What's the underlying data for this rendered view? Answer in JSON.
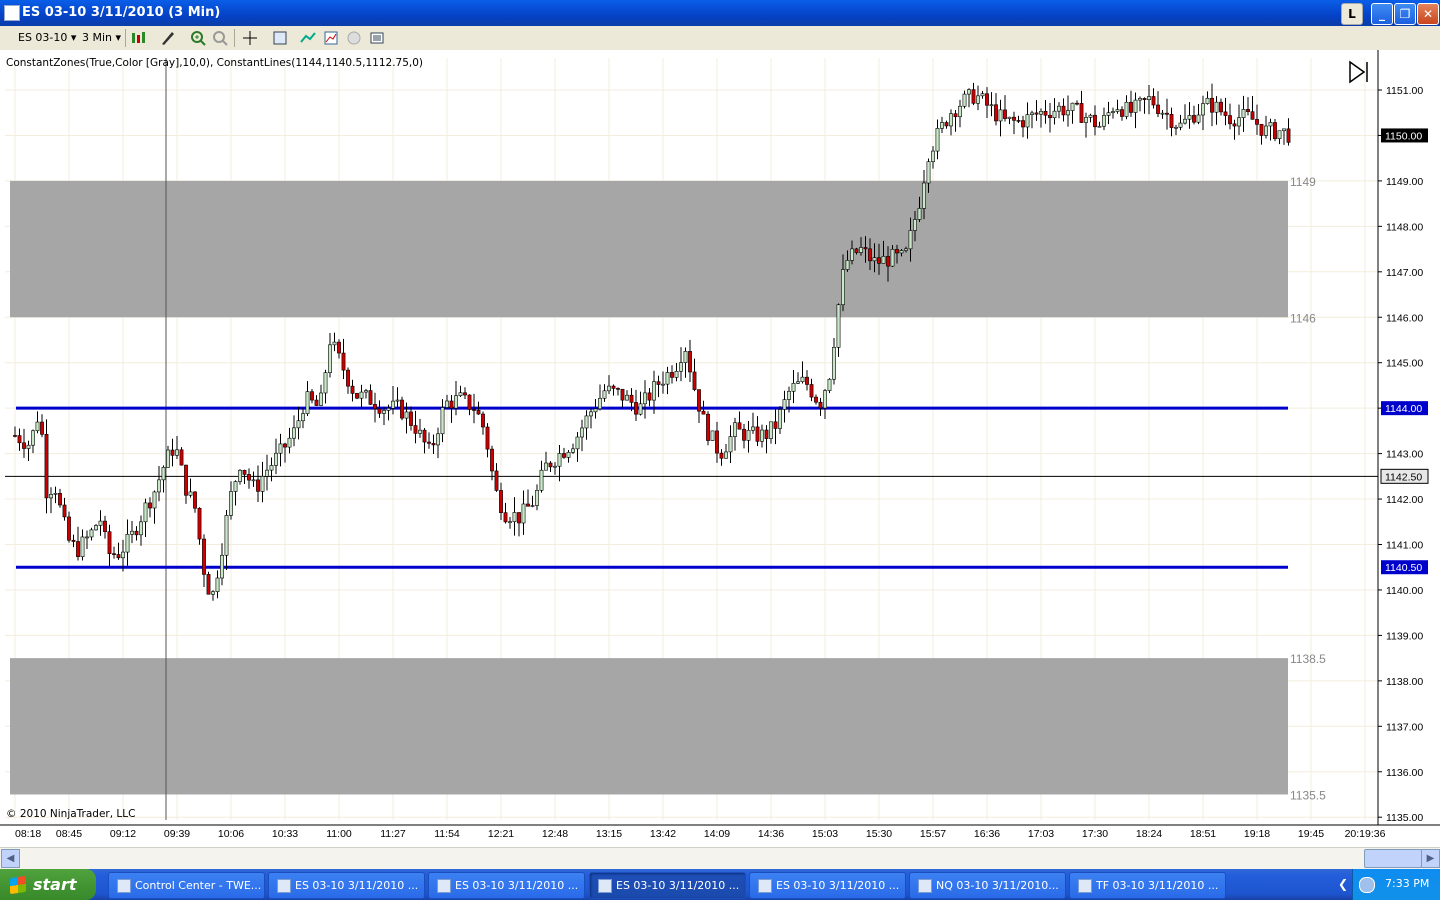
{
  "window": {
    "title": "ES 03-10  3/11/2010 (3 Min)",
    "btn_l": "L",
    "btn_min": "_",
    "btn_max": "❐",
    "btn_close": "✕"
  },
  "toolbar": {
    "instrument": "ES 03-10",
    "interval": "3 Min",
    "icons": [
      "bar-type-icon",
      "draw-tool-icon",
      "zoom-in-icon",
      "zoom-out-icon",
      "crosshair-icon",
      "data-box-icon",
      "indicators-icon",
      "strategies-icon",
      "chart-trader-icon",
      "properties-icon"
    ]
  },
  "chart": {
    "indicator_label": "ConstantZones(True,Color [Gray],10,0), ConstantLines(1144,1140.5,1112.75,0)",
    "copyright": "© 2010 NinjaTrader, LLC",
    "price_labels": [
      "1151.00",
      "1150.00",
      "1149.00",
      "1148.00",
      "1147.00",
      "1146.00",
      "1145.00",
      "1144.00",
      "1143.00",
      "1142.00",
      "1141.00",
      "1140.00",
      "1139.00",
      "1138.00",
      "1137.00",
      "1136.00",
      "1135.00"
    ],
    "time_labels": [
      "08:18",
      "08:45",
      "09:12",
      "09:39",
      "10:06",
      "10:33",
      "11:00",
      "11:27",
      "11:54",
      "12:21",
      "12:48",
      "13:15",
      "13:42",
      "14:09",
      "14:36",
      "15:03",
      "15:30",
      "15:57",
      "16:36",
      "17:03",
      "17:30",
      "18:24",
      "18:51",
      "19:18",
      "19:45",
      "20:19:36"
    ],
    "zones": [
      {
        "top_label": "1149",
        "bottom_label": "1146"
      },
      {
        "top_label": "1138.5",
        "bottom_label": "1135.5"
      }
    ],
    "line_markers": [
      "1144.00",
      "1140.50"
    ],
    "last_price": "1150.00",
    "crosshair_price": "1142.50",
    "colors": {
      "up": "#c8e8c8",
      "down": "#cc0000",
      "line": "#0000cc",
      "zone": "#a6a6a6"
    }
  },
  "taskbar": {
    "start": "start",
    "tasks": [
      {
        "label": "Control Center - TWE...",
        "active": false
      },
      {
        "label": "ES 03-10  3/11/2010 ...",
        "active": false
      },
      {
        "label": "ES 03-10  3/11/2010 ...",
        "active": false
      },
      {
        "label": "ES 03-10  3/11/2010 ...",
        "active": true
      },
      {
        "label": "ES 03-10  3/11/2010 ...",
        "active": false
      },
      {
        "label": "NQ 03-10  3/11/2010...",
        "active": false
      },
      {
        "label": "TF 03-10  3/11/2010 ...",
        "active": false
      }
    ],
    "clock": "7:33 PM"
  }
}
